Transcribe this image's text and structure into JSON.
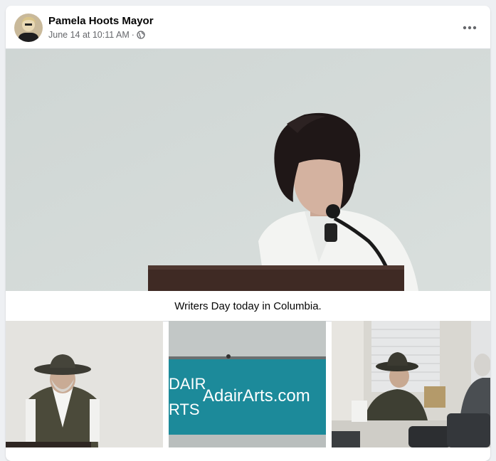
{
  "post": {
    "author": "Pamela Hoots Mayor",
    "timestamp": "June 14 at 10:11 AM",
    "separator": "·",
    "privacy_icon": "globe-icon",
    "more_icon": "more-options-icon",
    "caption": "Writers Day today in Columbia."
  },
  "banner": {
    "left_line1": "DAIR",
    "left_line2": "RTS",
    "site": "AdairArts.com",
    "color": "#1c8a9a"
  },
  "colors": {
    "name": "#050505",
    "meta": "#65676b",
    "card": "#ffffff",
    "page": "#eef0f3"
  }
}
